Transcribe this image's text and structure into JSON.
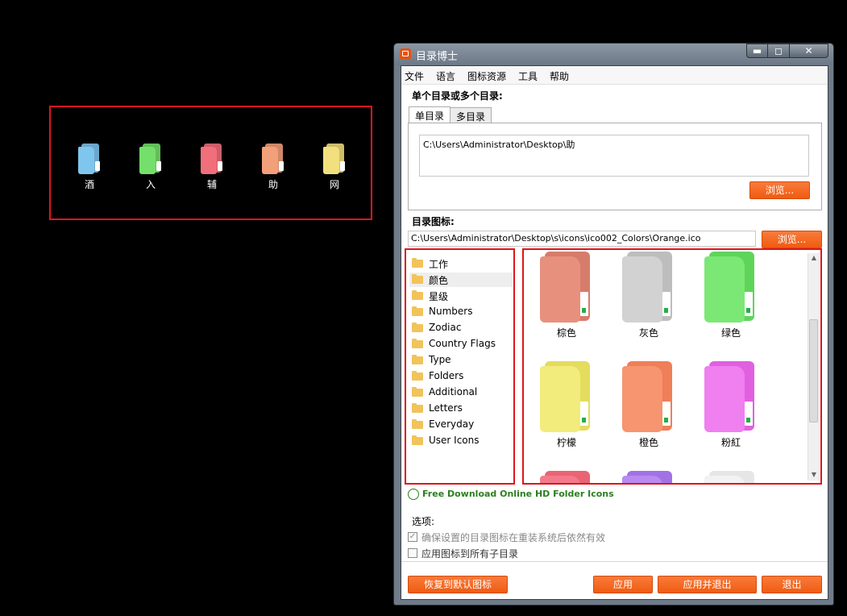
{
  "desktop": {
    "icons": [
      {
        "label": "酒",
        "color": "#7fc6ef"
      },
      {
        "label": "入",
        "color": "#74df6a"
      },
      {
        "label": "辅",
        "color": "#f06f7b"
      },
      {
        "label": "助",
        "color": "#f3a07a"
      },
      {
        "label": "网",
        "color": "#f2e07e"
      }
    ]
  },
  "window": {
    "title": "目录博士",
    "controls": {
      "minimize": "▬",
      "maximize": "◻",
      "close": "✕"
    }
  },
  "menu": [
    "文件",
    "语言",
    "图标资源",
    "工具",
    "帮助"
  ],
  "dirs": {
    "label": "单个目录或多个目录:",
    "tabs": [
      "单目录",
      "多目录"
    ],
    "path": "C:\\Users\\Administrator\\Desktop\\助",
    "browse": "浏览..."
  },
  "icon": {
    "label": "目录图标:",
    "path": "C:\\Users\\Administrator\\Desktop\\s\\icons\\ico002_Colors\\Orange.ico",
    "browse": "浏览..."
  },
  "tree": {
    "items": [
      "工作",
      "颜色",
      "星级",
      "Numbers",
      "Zodiac",
      "Country Flags",
      "Type",
      "Folders",
      "Additional",
      "Letters",
      "Everyday",
      "User Icons"
    ],
    "selected_index": 1
  },
  "grid": {
    "items": [
      {
        "label": "棕色",
        "color": "#e8907e",
        "back": "#d77c6b"
      },
      {
        "label": "灰色",
        "color": "#d2d2d2",
        "back": "#bdbdbd"
      },
      {
        "label": "绿色",
        "color": "#7be875",
        "back": "#5fd45a"
      },
      {
        "label": "柠檬",
        "color": "#f2ec7d",
        "back": "#e4dc5f"
      },
      {
        "label": "橙色",
        "color": "#f6956f",
        "back": "#ef7f58"
      },
      {
        "label": "粉紅",
        "color": "#f07ff0",
        "back": "#e060e0"
      },
      {
        "label": "",
        "color": "#f37a8a",
        "back": "#ea6474"
      },
      {
        "label": "",
        "color": "#b98af0",
        "back": "#a272e5"
      },
      {
        "label": "",
        "color": "#f2f2f2",
        "back": "#e6e6e6"
      }
    ]
  },
  "link": "Free Download Online HD Folder Icons",
  "options": {
    "label": "选项:",
    "items": [
      {
        "label": "确保设置的目录图标在重装系统后依然有效",
        "checked": true
      },
      {
        "label": "应用图标到所有子目录",
        "checked": false
      }
    ]
  },
  "buttons": {
    "restore": "恢复到默认图标",
    "apply": "应用",
    "apply_exit": "应用并退出",
    "exit": "退出"
  },
  "colors": {
    "accent": "#f26a22",
    "highlight": "#e0141c"
  }
}
